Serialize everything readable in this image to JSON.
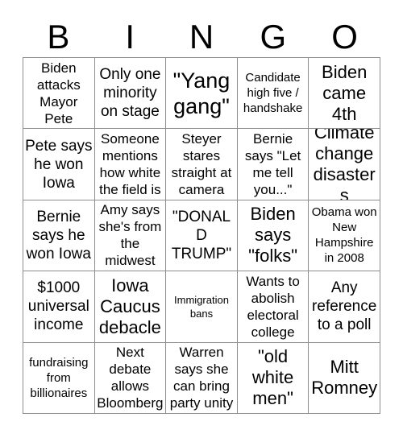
{
  "card": {
    "title": "BINGO",
    "header_letters": [
      "B",
      "I",
      "N",
      "G",
      "O"
    ],
    "grid_size": "5x5",
    "colors": {
      "background": "#ffffff",
      "text": "#000000",
      "grid_line": "#8d8d8d"
    },
    "columns": {
      "B": [
        "Biden attacks Mayor Pete",
        "Pete says he won Iowa",
        "Bernie says he won Iowa",
        "$1000 universal income",
        "fundraising from billionaires"
      ],
      "I": [
        "Only one minority on stage",
        "Someone mentions how white the field is",
        "Amy says she's from the midwest",
        "Iowa Caucus debacle",
        "Next debate allows Bloomberg"
      ],
      "N": [
        "\"Yang gang\"",
        "Steyer stares straight at camera",
        "\"DONALD TRUMP\"",
        "Immigration bans",
        "Warren says she can bring party unity"
      ],
      "G": [
        "Candidate high five / handshake",
        "Bernie says \"Let me tell you...\"",
        "Biden says \"folks\"",
        "Wants to abolish electoral college",
        "\"old white men\""
      ],
      "O": [
        "Biden came 4th",
        "Climate change disasters",
        "Obama won New Hampshire in 2008",
        "Any reference to a poll",
        "Mitt Romney"
      ]
    },
    "rows": [
      [
        "Biden attacks Mayor Pete",
        "Only one minority on stage",
        "\"Yang gang\"",
        "Candidate high five / handshake",
        "Biden came 4th"
      ],
      [
        "Pete says he won Iowa",
        "Someone mentions how white the field is",
        "Steyer stares straight at camera",
        "Bernie says \"Let me tell you...\"",
        "Climate change disasters"
      ],
      [
        "Bernie says he won Iowa",
        "Amy says she's from the midwest",
        "\"DONALD TRUMP\"",
        "Biden says \"folks\"",
        "Obama won New Hampshire in 2008"
      ],
      [
        "$1000 universal income",
        "Iowa Caucus debacle",
        "Immigration bans",
        "Wants to abolish electoral college",
        "Any reference to a poll"
      ],
      [
        "fundraising from billionaires",
        "Next debate allows Bloomberg",
        "Warren says she can bring party unity",
        "\"old white men\"",
        "Mitt Romney"
      ]
    ]
  }
}
